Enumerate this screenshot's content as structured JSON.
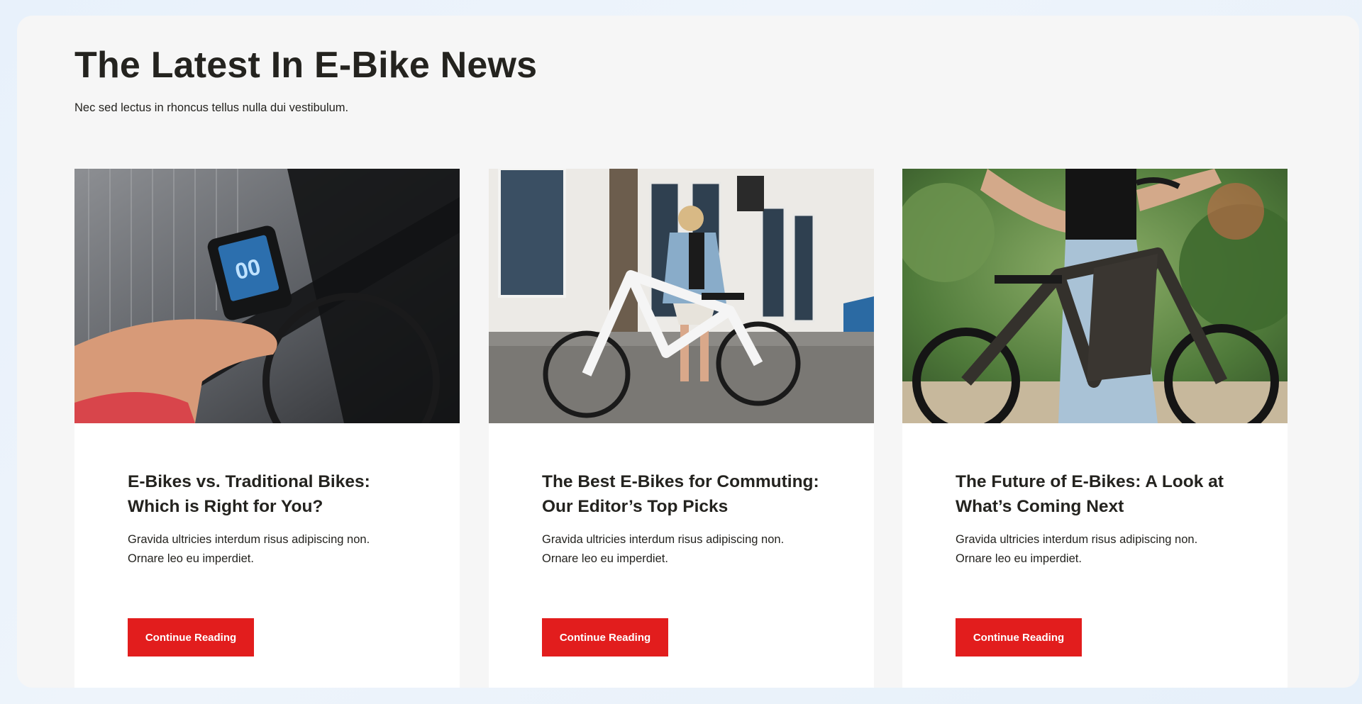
{
  "section": {
    "title": "The Latest In E-Bike News",
    "subtitle": "Nec sed lectus in rhoncus tellus nulla dui vestibulum."
  },
  "posts": [
    {
      "title_line1": "E-Bikes vs. Traditional Bikes:",
      "title_line2": "Which is Right for You?",
      "excerpt_line1": "Gravida ultricies interdum risus adipiscing non.",
      "excerpt_line2": "Ornare leo eu imperdiet.",
      "cta_label": "Continue Reading",
      "image_icon": "ebike-handlebar-display-photo",
      "display_reading": "00"
    },
    {
      "title_line1": "The Best E-Bikes for Commuting:",
      "title_line2": "Our Editor’s Top Picks",
      "excerpt_line1": "Gravida ultricies interdum risus adipiscing non.",
      "excerpt_line2": "Ornare leo eu imperdiet.",
      "cta_label": "Continue Reading",
      "image_icon": "woman-with-white-ebike-photo"
    },
    {
      "title_line1": "The Future of E-Bikes: A Look at",
      "title_line2": "What’s Coming Next",
      "excerpt_line1": "Gravida ultricies interdum risus adipiscing non.",
      "excerpt_line2": "Ornare leo eu imperdiet.",
      "cta_label": "Continue Reading",
      "image_icon": "rider-with-dark-ebike-photo"
    }
  ],
  "colors": {
    "accent": "#e21d1d",
    "heading": "#24231f",
    "panel": "#f6f6f6",
    "card": "#ffffff"
  }
}
